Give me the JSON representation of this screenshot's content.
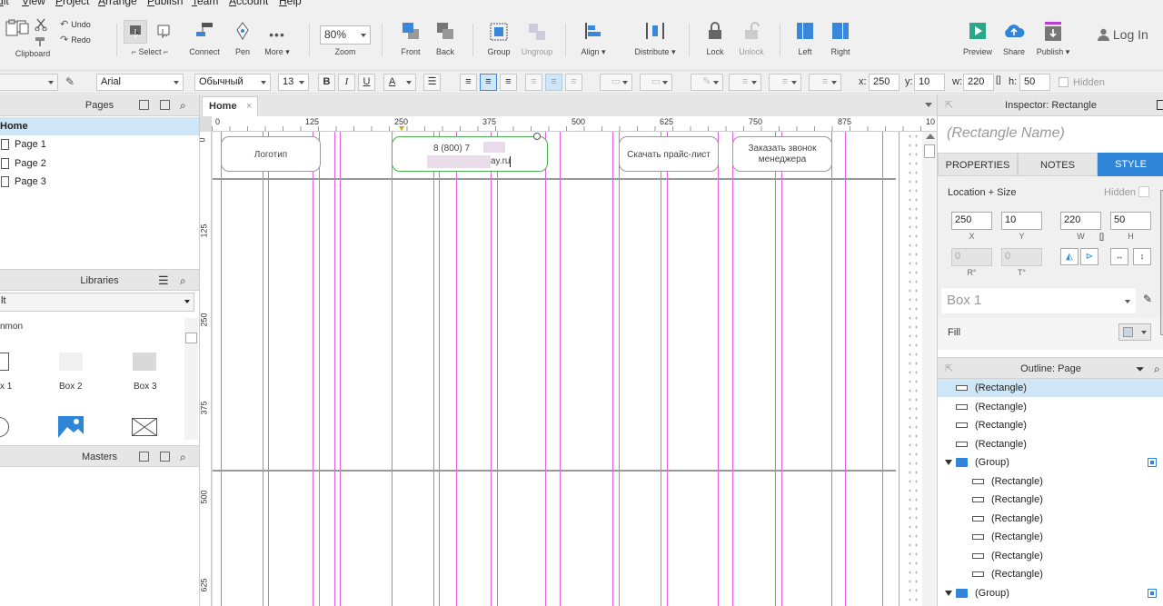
{
  "menu": [
    "dit",
    "View",
    "Project",
    "Arrange",
    "Publish",
    "Team",
    "Account",
    "Help"
  ],
  "toolbar": {
    "undo": "Undo",
    "redo": "Redo",
    "clipboard": "Clipboard",
    "select": "Select",
    "connect": "Connect",
    "pen": "Pen",
    "more": "More ▾",
    "zoom_value": "80%",
    "zoom": "Zoom",
    "front": "Front",
    "back": "Back",
    "group": "Group",
    "ungroup": "Ungroup",
    "align": "Align ▾",
    "distribute": "Distribute ▾",
    "lock": "Lock",
    "unlock": "Unlock",
    "left": "Left",
    "right": "Right",
    "preview": "Preview",
    "share": "Share",
    "publish": "Publish ▾",
    "login": "Log In"
  },
  "format": {
    "font": "Arial",
    "style": "Обычный",
    "size": "13",
    "bold": "B",
    "italic": "I",
    "underline": "U",
    "text_color": "A",
    "x_label": "x:",
    "x": "250",
    "y_label": "y:",
    "y": "10",
    "w_label": "w:",
    "w": "220",
    "h_label": "h:",
    "h": "50",
    "hidden": "Hidden"
  },
  "pages": {
    "title": "Pages",
    "items": [
      "Home",
      "Page 1",
      "Page 2",
      "Page 3"
    ]
  },
  "libraries": {
    "title": "Libraries",
    "selected": "lt",
    "section": "nmon",
    "items": [
      "x 1",
      "Box 2",
      "Box 3"
    ]
  },
  "masters": {
    "title": "Masters"
  },
  "canvas": {
    "tab": "Home",
    "ruler_h": [
      "0",
      "125",
      "250",
      "375",
      "500",
      "625",
      "750",
      "875",
      "10"
    ],
    "ruler_v": [
      "0",
      "125",
      "250",
      "375",
      "500",
      "625"
    ],
    "shapes": {
      "logo": "Логотип",
      "phone_line1": "8 (800) 7",
      "phone_line2": "ay.ru",
      "price": "Скачать прайс-лист",
      "call": "Заказать звонок менеджера"
    }
  },
  "inspector": {
    "title": "Inspector: Rectangle",
    "name_placeholder": "(Rectangle Name)",
    "tabs": [
      "PROPERTIES",
      "NOTES",
      "STYLE"
    ],
    "location_size": "Location + Size",
    "hidden": "Hidden",
    "x": "250",
    "y": "10",
    "w": "220",
    "h": "50",
    "x_label": "X",
    "y_label": "Y",
    "w_label": "W",
    "h_label": "H",
    "r": "0",
    "t": "0",
    "r_label": "R°",
    "t_label": "T°",
    "style_name": "Box 1",
    "fill": "Fill"
  },
  "outline": {
    "title": "Outline: Page",
    "items": [
      {
        "label": "(Rectangle)",
        "type": "rect",
        "indent": 0,
        "selected": true
      },
      {
        "label": "(Rectangle)",
        "type": "rect",
        "indent": 0
      },
      {
        "label": "(Rectangle)",
        "type": "rect",
        "indent": 0
      },
      {
        "label": "(Rectangle)",
        "type": "rect",
        "indent": 0
      },
      {
        "label": "(Group)",
        "type": "group",
        "indent": 0
      },
      {
        "label": "(Rectangle)",
        "type": "rect",
        "indent": 1
      },
      {
        "label": "(Rectangle)",
        "type": "rect",
        "indent": 1
      },
      {
        "label": "(Rectangle)",
        "type": "rect",
        "indent": 1
      },
      {
        "label": "(Rectangle)",
        "type": "rect",
        "indent": 1
      },
      {
        "label": "(Rectangle)",
        "type": "rect",
        "indent": 1
      },
      {
        "label": "(Rectangle)",
        "type": "rect",
        "indent": 1
      },
      {
        "label": "(Group)",
        "type": "group",
        "indent": 0
      }
    ]
  },
  "colors": {
    "accent": "#2f86d8",
    "guide": "#e85ce8",
    "selection": "#cfe6f7"
  }
}
